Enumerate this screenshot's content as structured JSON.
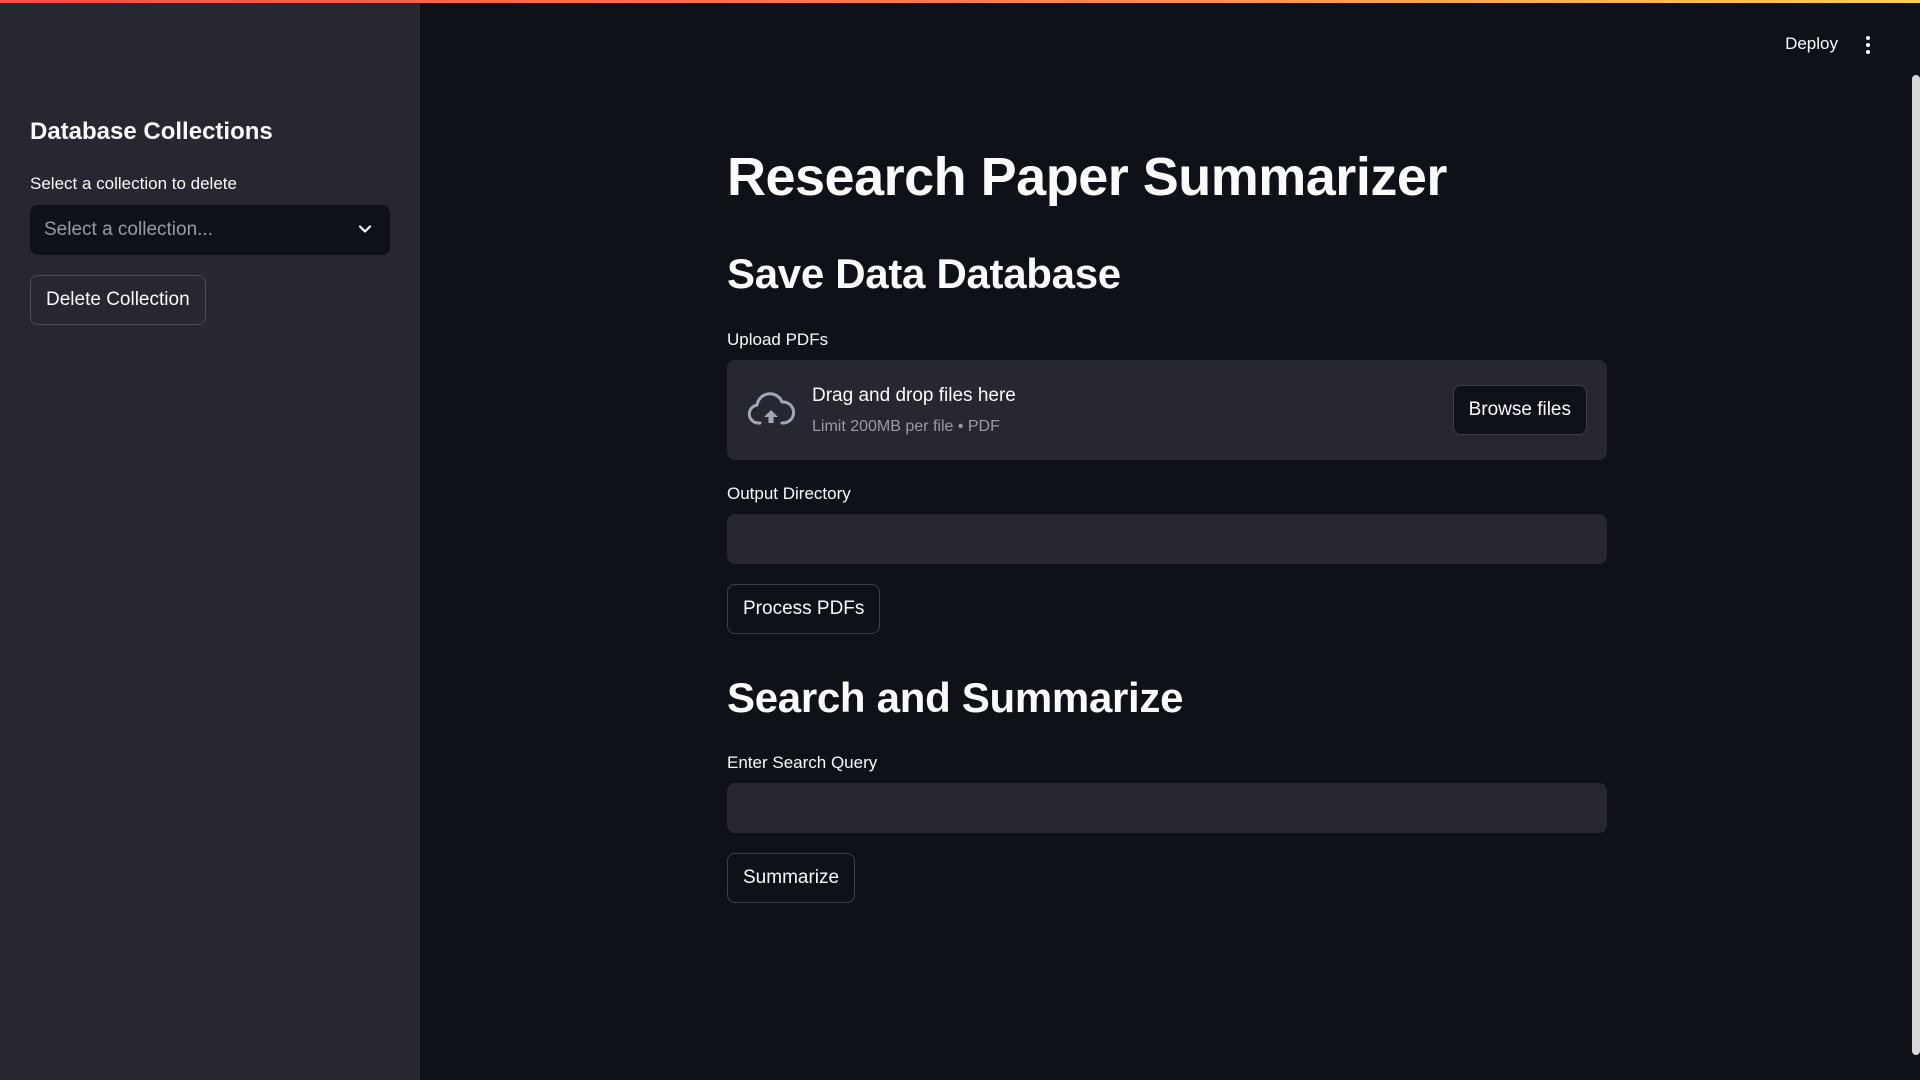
{
  "sidebar": {
    "title": "Database Collections",
    "select_label": "Select a collection to delete",
    "select_placeholder": "Select a collection...",
    "delete_button": "Delete Collection"
  },
  "header": {
    "deploy_label": "Deploy",
    "menu_icon": "kebab-menu-icon"
  },
  "main": {
    "title": "Research Paper Summarizer",
    "save_section": {
      "heading": "Save Data Database",
      "upload_label": "Upload PDFs",
      "dropzone_title": "Drag and drop files here",
      "dropzone_subtitle": "Limit 200MB per file • PDF",
      "browse_button": "Browse files",
      "output_label": "Output Directory",
      "output_value": "",
      "process_button": "Process PDFs"
    },
    "search_section": {
      "heading": "Search and Summarize",
      "query_label": "Enter Search Query",
      "query_value": "",
      "summarize_button": "Summarize"
    }
  },
  "colors": {
    "background": "#0e1117",
    "sidebar": "#262730",
    "accent_gradient_start": "#ff4b4b",
    "accent_gradient_end": "#ffd14b"
  }
}
